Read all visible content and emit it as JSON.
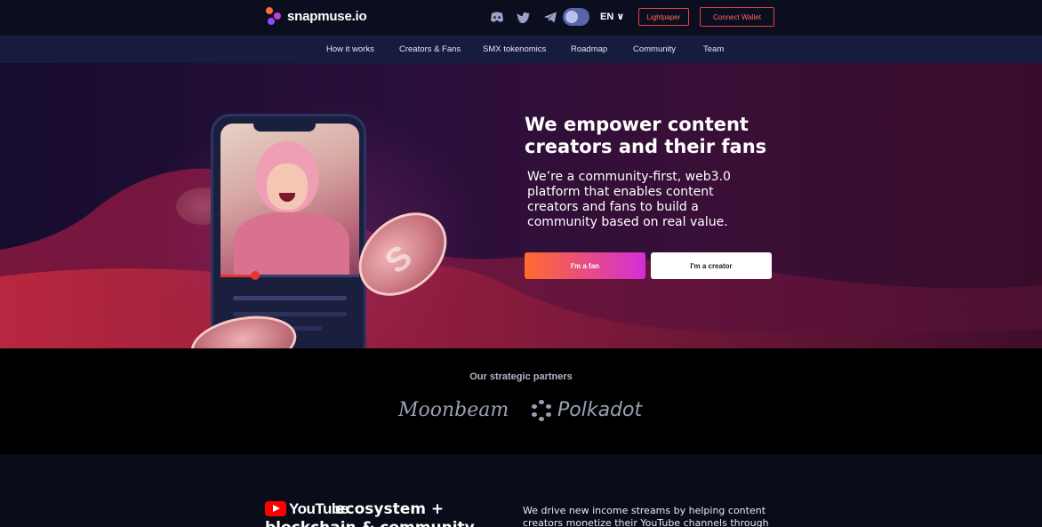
{
  "header": {
    "logo_text": "snapmuse.io",
    "lang": "EN",
    "lightpaper_label": "Lightpaper",
    "connect_wallet_label": "Connect Wallet",
    "socials": [
      "discord-icon",
      "twitter-icon",
      "telegram-icon"
    ]
  },
  "nav": {
    "items": [
      "How it works",
      "Creators & Fans",
      "SMX tokenomics",
      "Roadmap",
      "Community",
      "Team"
    ]
  },
  "hero": {
    "title": "We empower content creators and their fans",
    "subtitle": "We’re a community-first, web3.0 platform that enables content creators and fans to build a community based on real value.",
    "fan_button": "I'm a fan",
    "creator_button": "I'm a creator",
    "video_progress": 0.25,
    "coin_symbol": "S"
  },
  "partners": {
    "title": "Our strategic partners",
    "items": [
      "Moonbeam",
      "Polkadot"
    ]
  },
  "bottom": {
    "youtube_word": "YouTube",
    "title_rest": "ecosystem +",
    "title_line2": "blockchain & community",
    "text": "We drive new income streams by helping content creators monetize their YouTube channels through"
  },
  "colors": {
    "accent_red": "#e3433f",
    "gradient_start": "#ff6b2c",
    "gradient_end": "#d12fd6",
    "nav_bg": "#171b3d",
    "topbar_bg": "#0b0e1f"
  }
}
